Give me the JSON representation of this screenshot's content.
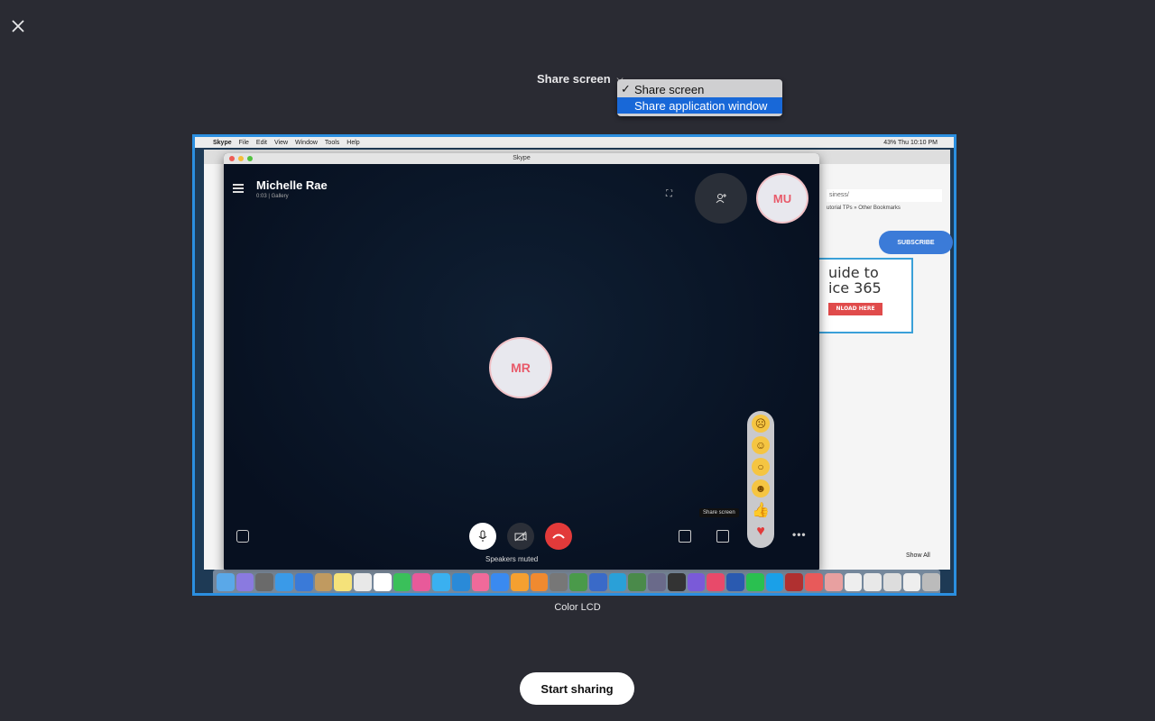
{
  "share_mode": {
    "label": "Share screen",
    "options": [
      {
        "label": "Share screen",
        "checked": true
      },
      {
        "label": "Share application window",
        "highlighted": true
      }
    ]
  },
  "preview": {
    "caption": "Color LCD",
    "mac_menu": {
      "apple": "",
      "app": "Skype",
      "items": [
        "File",
        "Edit",
        "View",
        "Window",
        "Tools",
        "Help"
      ],
      "status_right": "43%  Thu 10:10 PM"
    },
    "skype_window": {
      "title": "Skype",
      "caller_name": "Michelle Rae",
      "caller_sub": "0:03 | Gallery",
      "self_initials": "MU",
      "caller_initials": "MR",
      "tooltip": "Share screen",
      "status": "Speakers muted",
      "more": "•••"
    },
    "browser": {
      "address": "siness/",
      "bookmarks": "utorial TPs  »   Other Bookmarks",
      "subscribe": "SUBSCRIBE",
      "ad_line1": "uide to",
      "ad_line2": "ice 365",
      "ad_button": "NLOAD HERE",
      "show_all": "Show All"
    }
  },
  "start_button": "Start sharing",
  "colors": {
    "background": "#2a2b33",
    "accent": "#2b8fe0",
    "highlight": "#1868d8",
    "hangup": "#e23a3a"
  }
}
